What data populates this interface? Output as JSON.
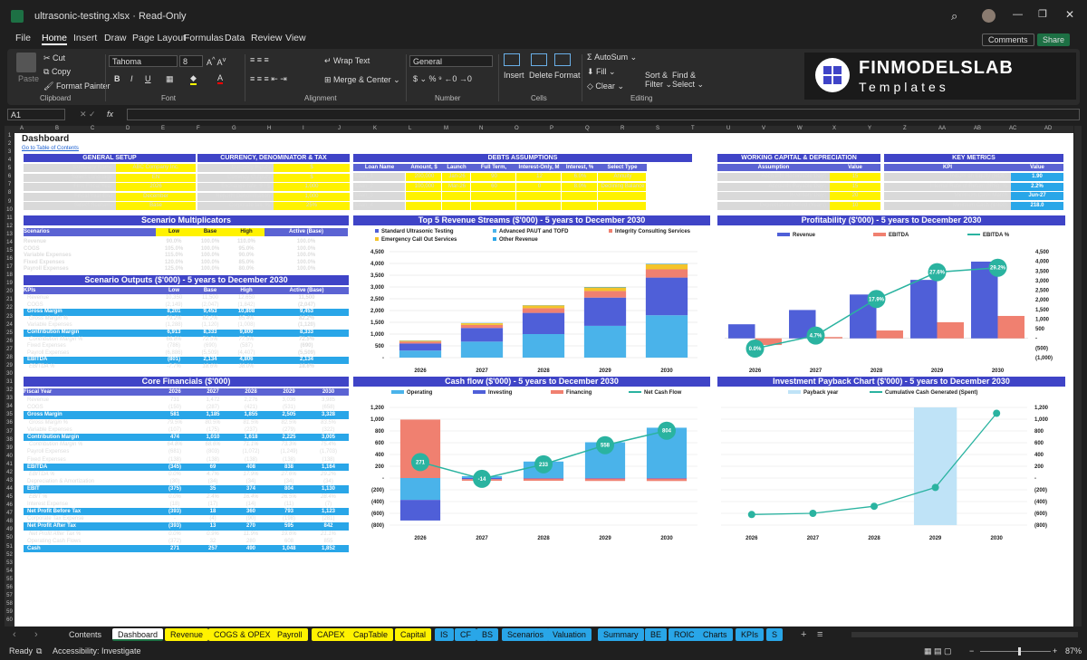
{
  "app": {
    "filename": "ultrasonic-testing.xlsx",
    "mode": "Read-Only",
    "comments": "Comments",
    "share": "Share"
  },
  "menu": [
    "File",
    "Home",
    "Insert",
    "Draw",
    "Page Layout",
    "Formulas",
    "Data",
    "Review",
    "View"
  ],
  "ribbon": {
    "paste": "Paste",
    "cut": "Cut",
    "copy": "Copy",
    "format_painter": "Format Painter",
    "clipboard": "Clipboard",
    "font_name": "Tahoma",
    "font_size": "8",
    "font": "Font",
    "wrap": "Wrap Text",
    "merge": "Merge & Center",
    "alignment": "Alignment",
    "number_format": "General",
    "number": "Number",
    "insert": "Insert",
    "delete": "Delete",
    "format": "Format",
    "cells": "Cells",
    "autosum": "AutoSum",
    "fill": "Fill",
    "clear": "Clear",
    "sort": "Sort &",
    "filter": "Filter",
    "find": "Find &",
    "select": "Select",
    "editing": "Editing",
    "logo_main": "FINMODELSLAB",
    "logo_sub": "Templates"
  },
  "formula": {
    "namebox": "A1",
    "fx": "fx"
  },
  "columns": [
    "A",
    "B",
    "C",
    "D",
    "E",
    "F",
    "G",
    "H",
    "I",
    "J",
    "K",
    "L",
    "M",
    "N",
    "O",
    "P",
    "Q",
    "R",
    "S",
    "T",
    "U",
    "V",
    "W",
    "X",
    "Y",
    "Z",
    "AA",
    "AB",
    "AC",
    "AD"
  ],
  "dash": {
    "title": "Dashboard",
    "link": "Go to Table of Contents"
  },
  "general": {
    "title": "GENERAL SETUP",
    "rows": [
      [
        "Company Name",
        "ABC Company Inc."
      ],
      [
        "Select Language",
        "EN"
      ],
      [
        "First Fiscal Year",
        "2026"
      ],
      [
        "Fiscal Year End",
        "December"
      ],
      [
        "Select Scenario",
        "Base"
      ]
    ]
  },
  "currency": {
    "title": "CURRENCY, DENOMINATOR & TAX",
    "rows": [
      [
        "Currency Inputs",
        "$"
      ],
      [
        "Currency Outputs",
        "$"
      ],
      [
        "Exchange rate, $ / $",
        "1.000"
      ],
      [
        "Reports Denomination",
        "1,000"
      ],
      [
        "Corporate tax, %",
        "25%"
      ]
    ]
  },
  "debts": {
    "title": "DEBTS ASSUMPTIONS",
    "headers": [
      "Loan Name",
      "Amount, $",
      "Launch",
      "Full Term, Months",
      "Interest-Only, M",
      "Interest, %",
      "Select Type"
    ],
    "rows": [
      [
        "Loan_1",
        "200,000",
        "Jan-26",
        "90",
        "12",
        "6.0%",
        "Annuity"
      ],
      [
        "Loan_2",
        "100,000",
        "Mar-26",
        "60",
        "0",
        "8.0%",
        "Declining Balance"
      ],
      [
        "Loan_3",
        "",
        "",
        "",
        "",
        "",
        ""
      ],
      [
        "Loan_4",
        "",
        "",
        "",
        "",
        "",
        ""
      ]
    ]
  },
  "wc": {
    "title": "WORKING CAPITAL & DEPRECIATION",
    "headers": [
      "Assumption",
      "Value"
    ],
    "rows": [
      [
        "Accounts Receivable Days",
        "15"
      ],
      [
        "Accounts Payable Days",
        "15"
      ],
      [
        "Inventory Days",
        "20"
      ],
      [
        "Depreciation Period (Years)",
        "10"
      ]
    ]
  },
  "kpi": {
    "title": "KEY METRICS",
    "headers": [
      "KPI",
      "Value"
    ],
    "rows": [
      [
        "Return on Equity (ROE)",
        "1.90"
      ],
      [
        "Internal Rate of Return (IRR), %",
        "2.2%"
      ],
      [
        "Minimum Cash Month",
        "Jun-27"
      ],
      [
        "Minimum Cash ($'000)",
        "218.0"
      ]
    ]
  },
  "scenario": {
    "title": "Scenario Multiplicators",
    "headers": [
      "Scenarios",
      "Low",
      "Base",
      "High",
      "Active (Base)"
    ],
    "rows": [
      [
        "Revenue",
        "90.0%",
        "100.0%",
        "110.0%",
        "100.0%"
      ],
      [
        "COGS",
        "105.0%",
        "100.0%",
        "95.0%",
        "100.0%"
      ],
      [
        "Variable Expenses",
        "115.0%",
        "100.0%",
        "90.0%",
        "100.0%"
      ],
      [
        "Fixed Expenses",
        "120.0%",
        "100.0%",
        "85.0%",
        "100.0%"
      ],
      [
        "Payroll Expenses",
        "125.0%",
        "100.0%",
        "80.0%",
        "100.0%"
      ]
    ]
  },
  "outputs": {
    "title": "Scenario Outputs ($'000) - 5 years to December 2030",
    "headers": [
      "KPIs",
      "Low",
      "Base",
      "High",
      "Active (Base)"
    ],
    "rows": [
      [
        "Revenue",
        "10,350",
        "11,500",
        "12,650",
        "11,500",
        "n"
      ],
      [
        "COGS",
        "(2,149)",
        "(2,047)",
        "(1,842)",
        "(2,047)",
        "n"
      ],
      [
        "Gross Margin",
        "8,201",
        "9,453",
        "10,808",
        "9,453",
        "b"
      ],
      [
        "Gross Margin %",
        "79.2%",
        "82.2%",
        "85.4%",
        "82.2%",
        "i"
      ],
      [
        "Variable Expenses",
        "(1,288)",
        "(1,120)",
        "(1,008)",
        "(1,120)",
        "n"
      ],
      [
        "Contribution Margin",
        "6,913",
        "8,333",
        "9,800",
        "8,333",
        "b"
      ],
      [
        "Contribution Margin %",
        "66.8%",
        "72.5%",
        "77.5%",
        "72.5%",
        "i"
      ],
      [
        "Fixed Expenses",
        "(786)",
        "(690)",
        "(587)",
        "(690)",
        "n"
      ],
      [
        "Payroll Expenses",
        "(6,886)",
        "(5,509)",
        "(4,407)",
        "(5,509)",
        "n"
      ],
      [
        "EBITDA",
        "(801)",
        "2,134",
        "4,806",
        "2,134",
        "b"
      ],
      [
        "EBITDA %",
        "-7.7%",
        "18.6%",
        "38.0%",
        "18.6%",
        "i"
      ]
    ]
  },
  "core": {
    "title": "Core Financials ($'000)",
    "headers": [
      "Fiscal Year",
      "2026",
      "2027",
      "2028",
      "2029",
      "2030"
    ],
    "rows": [
      [
        "Revenue",
        "731",
        "1,472",
        "2,276",
        "3,036",
        "3,985",
        "n"
      ],
      [
        "COGS",
        "(150)",
        "(287)",
        "(421)",
        "(531)",
        "(658)",
        "n"
      ],
      [
        "Gross Margin",
        "581",
        "1,185",
        "1,855",
        "2,505",
        "3,328",
        "b"
      ],
      [
        "Gross Margin %",
        "79.5%",
        "80.5%",
        "81.5%",
        "82.5%",
        "83.5%",
        "i"
      ],
      [
        "Variable Expenses",
        "(107)",
        "(175)",
        "(237)",
        "(279)",
        "(322)",
        "n"
      ],
      [
        "Contribution Margin",
        "474",
        "1,010",
        "1,618",
        "2,225",
        "3,005",
        "b"
      ],
      [
        "Contribution Margin %",
        "64.8%",
        "68.6%",
        "71.1%",
        "73.3%",
        "75.4%",
        "i"
      ],
      [
        "Payroll Expenses",
        "(681)",
        "(803)",
        "(1,072)",
        "(1,249)",
        "(1,703)",
        "n"
      ],
      [
        "Fixed Expenses",
        "(138)",
        "(138)",
        "(138)",
        "(138)",
        "(138)",
        "n"
      ],
      [
        "EBITDA",
        "(345)",
        "69",
        "408",
        "838",
        "1,164",
        "b"
      ],
      [
        "EBITDA %",
        "0.0%",
        "4.7%",
        "17.9%",
        "27.6%",
        "29.2%",
        "i"
      ],
      [
        "Depreciation & Amortization",
        "(30)",
        "(34)",
        "(34)",
        "(34)",
        "(34)",
        "n"
      ],
      [
        "EBIT",
        "(375)",
        "35",
        "374",
        "804",
        "1,130",
        "b"
      ],
      [
        "EBIT %",
        "0.0%",
        "2.4%",
        "16.4%",
        "26.5%",
        "28.4%",
        "i"
      ],
      [
        "Interest Expense",
        "(18)",
        "(17)",
        "(14)",
        "(11)",
        "(7)",
        "n"
      ],
      [
        "Net Profit Before Tax",
        "(393)",
        "18",
        "360",
        "793",
        "1,123",
        "b"
      ],
      [
        "Corporate Tax Expense",
        "-",
        "(4)",
        "(90)",
        "(198)",
        "(281)",
        "n"
      ],
      [
        "Net Profit After Tax",
        "(393)",
        "13",
        "270",
        "595",
        "842",
        "b"
      ],
      [
        "Net Profit After Tax %",
        "0.0%",
        "0.9%",
        "11.9%",
        "19.6%",
        "21.1%",
        "i"
      ],
      [
        "Operating Cash Flows",
        "(372)",
        "32",
        "280",
        "608",
        "855",
        "n"
      ],
      [
        "Cash",
        "271",
        "257",
        "490",
        "1,048",
        "1,852",
        "b"
      ]
    ]
  },
  "chart_data": [
    {
      "type": "bar",
      "title": "Top 5 Revenue Streams ($'000) - 5 years to December 2030",
      "categories": [
        "2026",
        "2027",
        "2028",
        "2029",
        "2030"
      ],
      "ylim": [
        0,
        4500
      ],
      "yticks": [
        "-",
        "500",
        "1,000",
        "1,500",
        "2,000",
        "2,500",
        "3,000",
        "3,500",
        "4,000",
        "4,500"
      ],
      "series": [
        {
          "name": "Standard Ultrasonic Testing",
          "color": "#4f5fd8",
          "values": [
            300,
            580,
            900,
            1200,
            1600
          ]
        },
        {
          "name": "Advanced PAUT and TOFD",
          "color": "#4ab3ea",
          "values": [
            300,
            680,
            1000,
            1350,
            1800
          ]
        },
        {
          "name": "Integrity Consulting Services",
          "color": "#f08070",
          "values": [
            80,
            130,
            200,
            280,
            350
          ]
        },
        {
          "name": "Emergency Call Out Services",
          "color": "#f4c42a",
          "values": [
            40,
            70,
            120,
            150,
            220
          ]
        },
        {
          "name": "Other Revenue",
          "color": "#29a6e8",
          "values": [
            10,
            10,
            10,
            20,
            20
          ]
        }
      ]
    },
    {
      "type": "bar",
      "title": "Profitability ($'000) - 5 years to December 2030",
      "categories": [
        "2026",
        "2027",
        "2028",
        "2029",
        "2030"
      ],
      "ylim": [
        -1000,
        4500
      ],
      "yticks": [
        "(1,000)",
        "(500)",
        "-",
        "500",
        "1,000",
        "1,500",
        "2,000",
        "2,500",
        "3,000",
        "3,500",
        "4,000",
        "4,500"
      ],
      "series": [
        {
          "name": "Revenue",
          "color": "#4f5fd8",
          "values": [
            731,
            1472,
            2276,
            3036,
            3985
          ]
        },
        {
          "name": "EBITDA",
          "color": "#f08070",
          "values": [
            -345,
            69,
            408,
            838,
            1164
          ]
        },
        {
          "name": "EBITDA %",
          "color": "#2ab3a0",
          "values": [
            0.0,
            4.7,
            17.9,
            27.6,
            29.2
          ],
          "labels": [
            "0.0%",
            "4.7%",
            "17.9%",
            "27.6%",
            "29.2%"
          ]
        }
      ]
    },
    {
      "type": "bar",
      "title": "Cash flow ($'000) - 5 years to December 2030",
      "categories": [
        "2026",
        "2027",
        "2028",
        "2029",
        "2030"
      ],
      "ylim": [
        -800,
        1200
      ],
      "yticks": [
        "(800)",
        "(600)",
        "(400)",
        "(200)",
        "-",
        "200",
        "400",
        "600",
        "800",
        "1,000",
        "1,200"
      ],
      "series": [
        {
          "name": "Operating",
          "color": "#4ab3ea",
          "values": [
            -372,
            32,
            280,
            608,
            855
          ]
        },
        {
          "name": "Investing",
          "color": "#4f5fd8",
          "values": [
            -350,
            -20,
            -10,
            -10,
            -10
          ]
        },
        {
          "name": "Financing",
          "color": "#f08070",
          "values": [
            993,
            -26,
            -37,
            -40,
            -41
          ]
        },
        {
          "name": "Net Cash Flow",
          "color": "#2ab3a0",
          "values": [
            271,
            -14,
            233,
            558,
            804
          ],
          "labels": [
            "271",
            "-14",
            "233",
            "558",
            "804"
          ]
        }
      ]
    },
    {
      "type": "line",
      "title": "Investment Payback Chart ($'000) - 5 years to December 2030",
      "categories": [
        "2026",
        "2027",
        "2028",
        "2029",
        "2030"
      ],
      "ylim": [
        -800,
        1200
      ],
      "yticks": [
        "(800)",
        "(600)",
        "(400)",
        "(200)",
        "-",
        "200",
        "400",
        "600",
        "800",
        "1,000",
        "1,200"
      ],
      "series": [
        {
          "name": "Payback year",
          "color": "#bfe3f7",
          "values": [
            0,
            0,
            0,
            1,
            0
          ]
        },
        {
          "name": "Cumulative Cash Generated (Spent)",
          "color": "#2ab3a0",
          "values": [
            -620,
            -600,
            -480,
            -160,
            1100
          ]
        }
      ]
    }
  ],
  "tabs": [
    {
      "label": "Contents",
      "color": "#1f1f1f",
      "text": "#ddd"
    },
    {
      "label": "Dashboard",
      "color": "#fff",
      "text": "#111"
    },
    {
      "label": "Revenue",
      "color": "#fff200"
    },
    {
      "label": "COGS & OPEX",
      "color": "#fff200"
    },
    {
      "label": "Payroll",
      "color": "#fff200"
    },
    {
      "label": "CAPEX",
      "color": "#fff200"
    },
    {
      "label": "CapTable",
      "color": "#fff200"
    },
    {
      "label": "Capital",
      "color": "#fff200"
    },
    {
      "label": "IS",
      "color": "#29a6e8"
    },
    {
      "label": "CF",
      "color": "#29a6e8"
    },
    {
      "label": "BS",
      "color": "#29a6e8"
    },
    {
      "label": "Scenarios",
      "color": "#29a6e8"
    },
    {
      "label": "Valuation",
      "color": "#29a6e8"
    },
    {
      "label": "Summary",
      "color": "#29a6e8"
    },
    {
      "label": "BE",
      "color": "#29a6e8"
    },
    {
      "label": "ROIC",
      "color": "#29a6e8"
    },
    {
      "label": "Charts",
      "color": "#29a6e8"
    },
    {
      "label": "KPIs",
      "color": "#29a6e8"
    },
    {
      "label": "S",
      "color": "#29a6e8"
    }
  ],
  "status": {
    "ready": "Ready",
    "accessibility": "Accessibility: Investigate",
    "zoom": "87%"
  }
}
